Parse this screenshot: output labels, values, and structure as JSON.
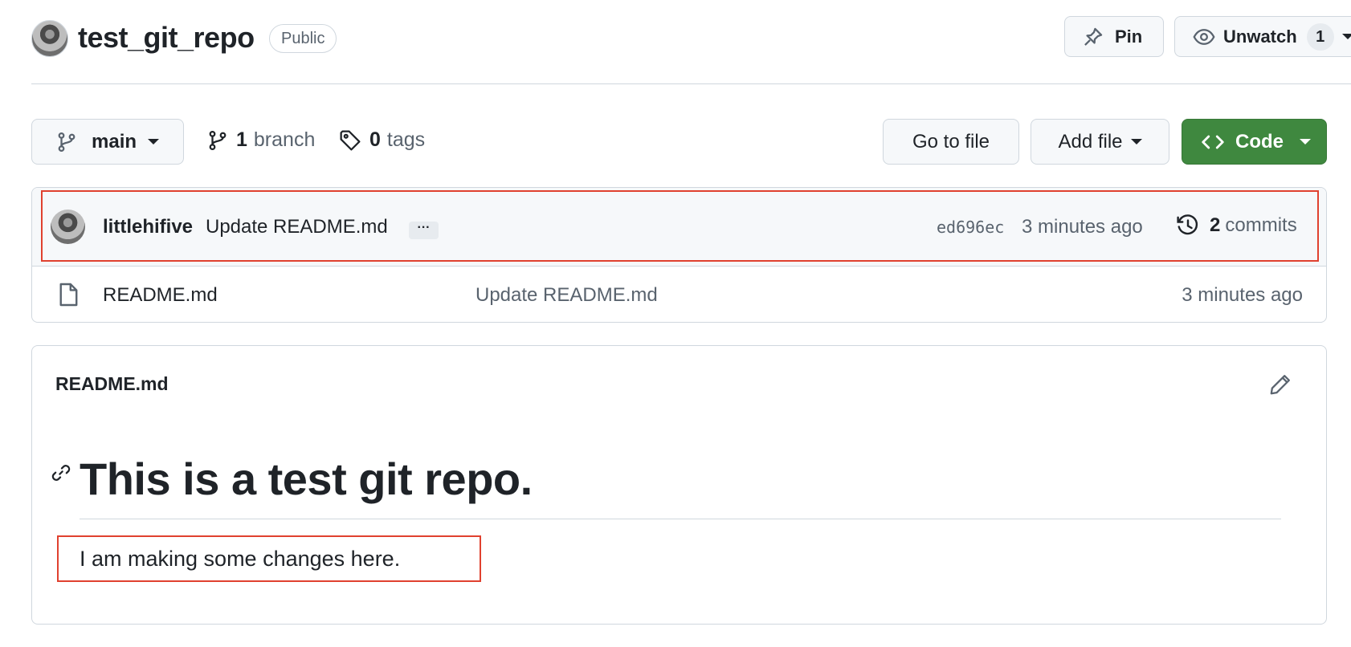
{
  "header": {
    "repo_name": "test_git_repo",
    "visibility": "Public",
    "pin_label": "Pin",
    "watch_label": "Unwatch",
    "watch_count": "1"
  },
  "toolbar": {
    "branch": "main",
    "branch_count": "1",
    "branch_word": "branch",
    "tag_count": "0",
    "tag_word": "tags",
    "go_to_file": "Go to file",
    "add_file": "Add file",
    "code": "Code"
  },
  "latest_commit": {
    "author": "littlehifive",
    "message": "Update README.md",
    "ellipsis": "···",
    "sha": "ed696ec",
    "time": "3 minutes ago",
    "commit_count": "2",
    "commits_word": "commits"
  },
  "files": [
    {
      "name": "README.md",
      "message": "Update README.md",
      "time": "3 minutes ago",
      "icon": "file-icon"
    }
  ],
  "readme": {
    "title": "README.md",
    "heading": "This is a test git repo.",
    "paragraph": "I am making some changes here."
  },
  "colors": {
    "primary_button": "#3f883f",
    "highlight": "#e0412f",
    "border": "#d0d7de",
    "muted_text": "#59636e"
  }
}
